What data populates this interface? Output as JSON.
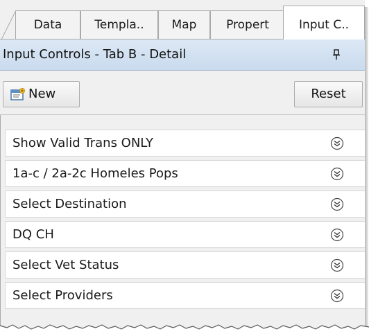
{
  "tabs": [
    {
      "label": "Data"
    },
    {
      "label": "Templa.."
    },
    {
      "label": "Map"
    },
    {
      "label": "Propert"
    },
    {
      "label": "Input C.."
    }
  ],
  "panel": {
    "title": "Input Controls - Tab B - Detail",
    "pin_icon": "pin-icon"
  },
  "toolbar": {
    "new_label": "New",
    "reset_label": "Reset"
  },
  "controls": [
    {
      "label": "Show Valid Trans ONLY"
    },
    {
      "label": "1a-c / 2a-2c  Homeles Pops"
    },
    {
      "label": "Select Destination"
    },
    {
      "label": "DQ CH"
    },
    {
      "label": "Select Vet Status"
    },
    {
      "label": "Select Providers"
    }
  ],
  "colors": {
    "header_bg": "#c9dbee",
    "frame_bg": "#f0f0f0"
  }
}
